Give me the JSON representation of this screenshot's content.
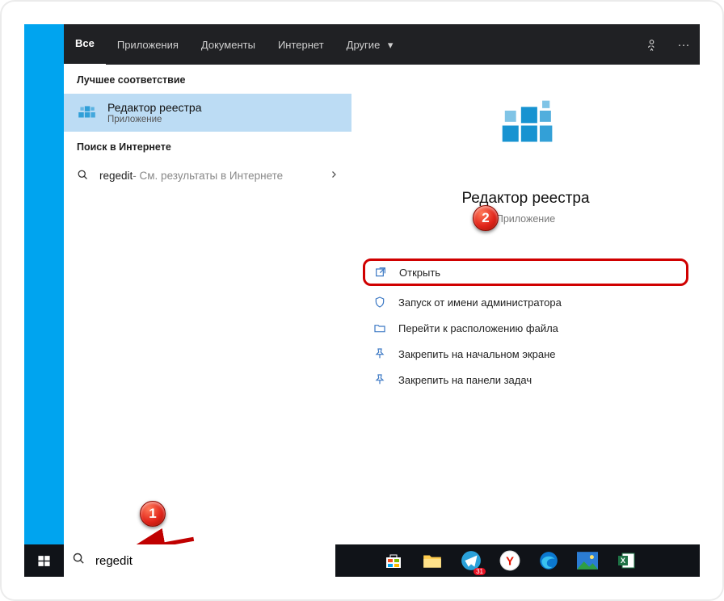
{
  "header": {
    "tabs": {
      "all": "Все",
      "apps": "Приложения",
      "docs": "Документы",
      "internet": "Интернет",
      "other": "Другие"
    }
  },
  "left": {
    "best_header": "Лучшее соответствие",
    "best_title": "Редактор реестра",
    "best_sub": "Приложение",
    "inet_header": "Поиск в Интернете",
    "inet_query": "regedit",
    "inet_hint": " - См. результаты в Интернете"
  },
  "right": {
    "title": "Редактор реестра",
    "subtitle": "Приложение",
    "actions": {
      "open": "Открыть",
      "admin": "Запуск от имени администратора",
      "loc": "Перейти к расположению файла",
      "pin_start": "Закрепить на начальном экране",
      "pin_task": "Закрепить на панели задач"
    }
  },
  "search": {
    "value": "regedit"
  },
  "badges": {
    "one": "1",
    "two": "2"
  }
}
